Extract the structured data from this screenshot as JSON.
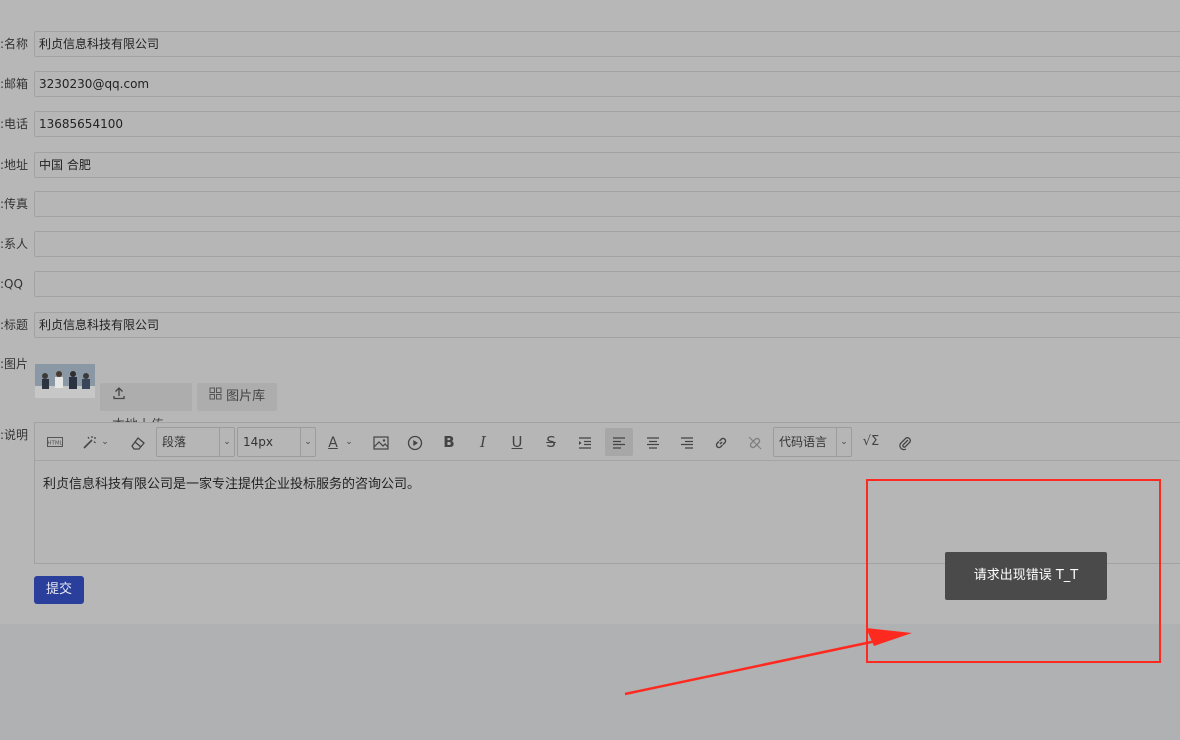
{
  "form": {
    "fields": [
      {
        "label": "名称:",
        "value": "利贞信息科技有限公司"
      },
      {
        "label": "邮箱:",
        "value": "3230230@qq.com"
      },
      {
        "label": "电话:",
        "value": "13685654100"
      },
      {
        "label": "地址:",
        "value": "中国 合肥"
      },
      {
        "label": "传真:",
        "value": ""
      },
      {
        "label": "系人:",
        "value": ""
      },
      {
        "label": "QQ:",
        "value": ""
      },
      {
        "label": "标题:",
        "value": "利贞信息科技有限公司"
      }
    ],
    "image_label": "图片:",
    "upload_button": "本地上传",
    "library_button": "图片库",
    "description_label": "说明:",
    "submit_label": "提交"
  },
  "editor": {
    "paragraph_select": "段落",
    "fontsize_select": "14px",
    "code_lang_select": "代码语言",
    "content": "利贞信息科技有限公司是一家专注提供企业投标服务的咨询公司。",
    "toolbar_icons": [
      "html-icon",
      "magic-wand-icon",
      "eraser-icon",
      "font-color-icon",
      "image-icon",
      "video-icon",
      "bold-icon",
      "italic-icon",
      "underline-icon",
      "strikethrough-icon",
      "indent-icon",
      "align-left-icon",
      "align-center-icon",
      "align-right-icon",
      "link-icon",
      "unlink-icon",
      "formula-icon",
      "attachment-icon"
    ]
  },
  "toast": {
    "message": "请求出现错误 T_T"
  },
  "colors": {
    "annotation": "#ff2a1f",
    "submit": "#2a3f9c",
    "toast": "#4a4a4a"
  }
}
